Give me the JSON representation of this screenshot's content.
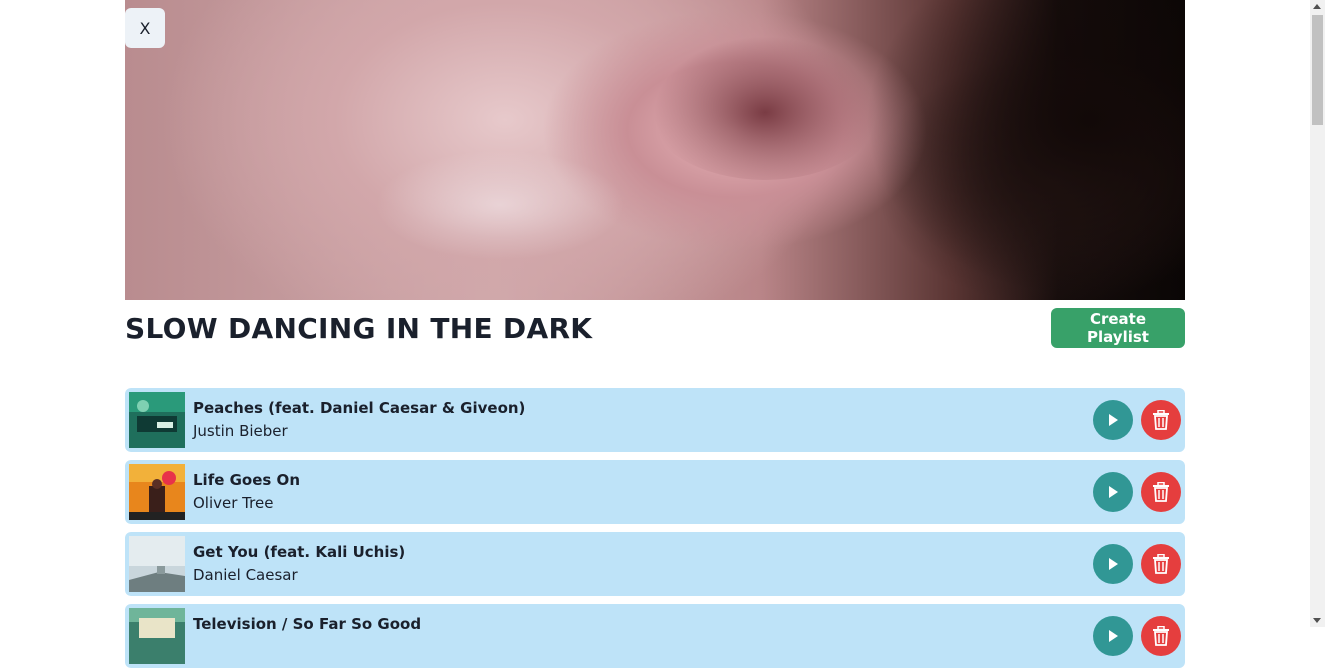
{
  "hero": {
    "image_desc_icon": "album-cover-image"
  },
  "close_button": {
    "label": "X"
  },
  "playlist": {
    "title": "SLOW DANCING IN THE DARK"
  },
  "create_button": {
    "label": "Create Playlist"
  },
  "tracks": [
    {
      "title": "Peaches (feat. Daniel Caesar & Giveon)",
      "artist": "Justin Bieber"
    },
    {
      "title": "Life Goes On",
      "artist": "Oliver Tree"
    },
    {
      "title": "Get You (feat. Kali Uchis)",
      "artist": "Daniel Caesar"
    },
    {
      "title": "Television / So Far So Good",
      "artist": ""
    }
  ],
  "colors": {
    "accent_green": "#38a169",
    "row_bg": "#bee3f8",
    "play": "#319795",
    "delete": "#e53e3e"
  }
}
